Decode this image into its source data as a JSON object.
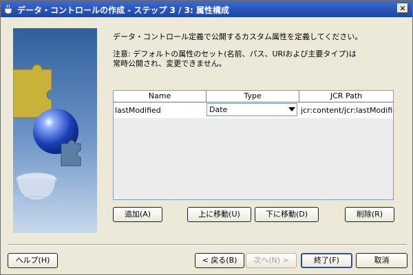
{
  "window": {
    "title": "データ・コントロールの作成 - ステップ 3 / 3: 属性構成",
    "close_glyph": "✕"
  },
  "description": {
    "line1": "データ・コントロール定義で公開するカスタム属性を定義してください。",
    "note_line1": "注意: デフォルトの属性のセット(名前、パス、URIおよび主要タイプ)は",
    "note_line2": "常時公開され、変更できません。"
  },
  "table": {
    "columns": [
      "Name",
      "Type",
      "JCR Path"
    ],
    "rows": [
      {
        "name": "lastModified",
        "type": "Date",
        "jcr_path": "jcr:content/jcr:lastModified"
      }
    ]
  },
  "table_buttons": {
    "add": "追加(A)",
    "move_up": "上に移動(U)",
    "move_down": "下に移動(D)",
    "delete": "削除(R)"
  },
  "footer": {
    "help": "ヘルプ(H)",
    "back": "< 戻る(B)",
    "next": "次へ(N) >",
    "finish": "終了(F)",
    "cancel": "取消"
  },
  "colors": {
    "title_bar": "#2753b8",
    "dialog_bg": "#ece9d8",
    "art_bg": "#3f6fb0"
  },
  "icons": {
    "title_icon": "coffee-cup-icon",
    "art": "puzzle-globe-cup-art"
  }
}
